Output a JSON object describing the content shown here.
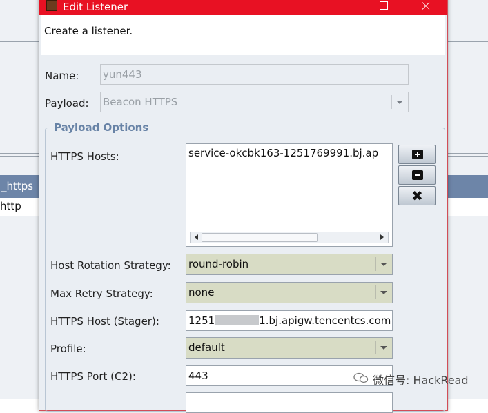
{
  "background": {
    "row_selected": "_https",
    "row_second": "http"
  },
  "dialog": {
    "title": "Edit Listener",
    "description": "Create a listener.",
    "name_label": "Name:",
    "name_value": "yun443",
    "payload_label": "Payload:",
    "payload_value": "Beacon HTTPS",
    "group_title": "Payload Options",
    "https_hosts_label": "HTTPS Hosts:",
    "https_hosts_items": [
      "service-okcbk163-1251769991.bj.ap"
    ],
    "host_rotation_label": "Host Rotation Strategy:",
    "host_rotation_value": "round-robin",
    "max_retry_label": "Max Retry Strategy:",
    "max_retry_value": "none",
    "stager_host_label": "HTTPS Host (Stager):",
    "stager_host_prefix": "1251",
    "stager_host_suffix": "1.bj.apigw.tencentcs.com",
    "profile_label": "Profile:",
    "profile_value": "default",
    "port_c2_label": "HTTPS Port (C2):",
    "port_c2_value": "443"
  },
  "watermark": {
    "text": "微信号: HackRead"
  },
  "colors": {
    "titlebar": "#e81123",
    "group_title": "#6883a6",
    "combo_bg": "#d8dcc5",
    "selected_row": "#6d85a8"
  }
}
